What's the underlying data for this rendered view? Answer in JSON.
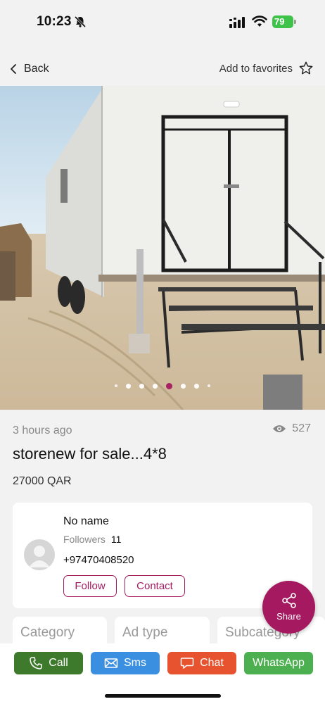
{
  "status_bar": {
    "time": "10:23",
    "battery": "79"
  },
  "nav": {
    "back_label": "Back",
    "favorites_label": "Add to favorites"
  },
  "gallery": {
    "total_images": 8,
    "active_index": 4
  },
  "ad": {
    "posted": "3 hours ago",
    "views": "527",
    "title": "storenew for sale...4*8",
    "price": "27000 QAR"
  },
  "seller": {
    "name": "No name",
    "followers_label": "Followers",
    "followers_count": "11",
    "phone": "+97470408520",
    "follow_label": "Follow",
    "contact_label": "Contact"
  },
  "share": {
    "label": "Share"
  },
  "info_cards": {
    "category": "Category",
    "ad_type": "Ad type",
    "subcategory": "Subcategory"
  },
  "actions": {
    "call": "Call",
    "sms": "Sms",
    "chat": "Chat",
    "whatsapp": "WhatsApp"
  },
  "colors": {
    "brand": "#a4195f",
    "call": "#3d7a2c",
    "sms": "#3b8fe0",
    "chat": "#e8532f",
    "whatsapp": "#4caf50"
  }
}
